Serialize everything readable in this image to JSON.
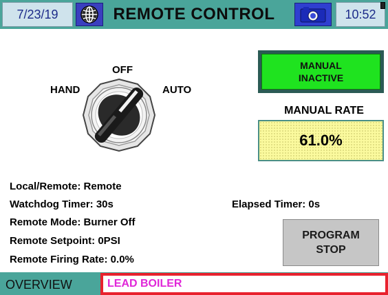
{
  "header": {
    "date": "7/23/19",
    "title": "REMOTE CONTROL",
    "time": "10:52"
  },
  "selector_switch": {
    "off_label": "OFF",
    "hand_label": "HAND",
    "auto_label": "AUTO",
    "position": "AUTO"
  },
  "manual_button": {
    "line1": "MANUAL",
    "line2": "INACTIVE"
  },
  "manual_rate": {
    "label": "MANUAL RATE",
    "value": "61.0%"
  },
  "status": {
    "local_remote": "Local/Remote:  Remote",
    "watchdog": "Watchdog Timer:  30s",
    "remote_mode": "Remote Mode:  Burner Off",
    "remote_setpoint": "Remote Setpoint:  0PSI",
    "remote_firing_rate": "Remote Firing Rate: 0.0%",
    "elapsed": "Elapsed Timer:  0s"
  },
  "program_stop": {
    "line1": "PROGRAM",
    "line2": "STOP"
  },
  "footer": {
    "overview": "OVERVIEW",
    "lead": "LEAD BOILER"
  },
  "colors": {
    "header_teal": "#4aa59a",
    "manual_green": "#1fe31f",
    "rate_yellow": "#fbfa9e",
    "alert_red": "#e8222e",
    "lead_magenta": "#e026d8"
  },
  "icons": [
    "globe-icon",
    "camera-icon",
    "battery-icon"
  ]
}
